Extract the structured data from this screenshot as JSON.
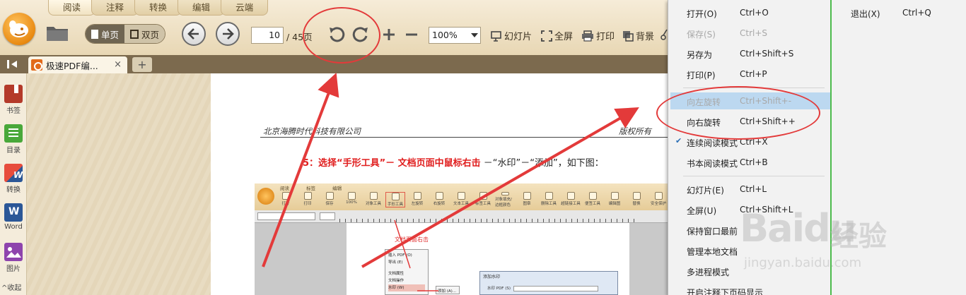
{
  "ribbon": {
    "tabs": [
      "阅读",
      "注释",
      "转换",
      "编辑",
      "云端"
    ]
  },
  "toolbar": {
    "single_page": "单页",
    "double_page": "双页",
    "page_current": "10",
    "page_total": "/ 45页",
    "zoom": "100%",
    "slideshow": "幻灯片",
    "fullscreen": "全屏",
    "print": "打印",
    "background": "背景"
  },
  "doc_tabs": {
    "active_title": "极速PDF编...",
    "close": "×",
    "add": "+"
  },
  "sidebar": {
    "items": [
      {
        "label": "书签",
        "icon": "bookmark-icon",
        "color": "#c0392b"
      },
      {
        "label": "目录",
        "icon": "toc-icon",
        "color": "#3aa33a"
      },
      {
        "label": "转换",
        "icon": "convert-icon",
        "color": "#e74c3c"
      },
      {
        "label": "Word",
        "icon": "word-icon",
        "color": "#2b5797"
      },
      {
        "label": "图片",
        "icon": "image-icon",
        "color": "#8e44ad"
      }
    ],
    "collapse": "^收起"
  },
  "page": {
    "header_left": "北京海腾时代科技有限公司",
    "header_right": "版权所有",
    "step_num": "5",
    "step_red1": "：选择“手形工具”－ 文档页面中鼠标右击",
    "step_black": " －“水印”－“添加”，如下图："
  },
  "embedded": {
    "tabs": "阅读 标签 编辑",
    "tools": [
      "打开",
      "打印",
      "保存",
      "100%",
      "对象工具",
      "手形工具",
      "左旋转",
      "右旋转",
      "文本工具",
      "标签工具",
      "对象填充/边框颜色",
      "图章",
      "删除工具",
      "超链接工具",
      "便签工具",
      "编辑图",
      "替换",
      "安全保护"
    ],
    "note": "文档页面右击",
    "menu": [
      "插入 PDF (O)",
      "导出 (E)",
      "",
      "文档属性",
      "文档操作",
      "水印 (W)"
    ],
    "submenu": "添加 (A)...",
    "dialog_title": "添加水印",
    "dialog_field": "水印 PDF (S)"
  },
  "menu": {
    "items": [
      {
        "label": "打开(O)",
        "key": "Ctrl+O",
        "state": "normal"
      },
      {
        "label": "保存(S)",
        "key": "Ctrl+S",
        "state": "disabled"
      },
      {
        "label": "另存为",
        "key": "Ctrl+Shift+S",
        "state": "normal"
      },
      {
        "label": "打印(P)",
        "key": "Ctrl+P",
        "state": "normal"
      },
      {
        "label": "向左旋转",
        "key": "Ctrl+Shift+-",
        "state": "highlight"
      },
      {
        "label": "向右旋转",
        "key": "Ctrl+Shift++",
        "state": "normal"
      },
      {
        "label": "连续阅读模式",
        "key": "Ctrl+X",
        "state": "checked"
      },
      {
        "label": "书本阅读模式",
        "key": "Ctrl+B",
        "state": "normal"
      },
      {
        "label": "幻灯片(E)",
        "key": "Ctrl+L",
        "state": "normal"
      },
      {
        "label": "全屏(U)",
        "key": "Ctrl+Shift+L",
        "state": "normal"
      },
      {
        "label": "保持窗口最前",
        "key": "",
        "state": "normal"
      },
      {
        "label": "管理本地文档",
        "key": "",
        "state": "normal"
      },
      {
        "label": "多进程模式",
        "key": "",
        "state": "normal"
      },
      {
        "label": "开启注释下页码显示",
        "key": "",
        "state": "normal"
      }
    ],
    "exit_label": "退出(X)",
    "exit_key": "Ctrl+Q"
  },
  "watermark": {
    "brand": "Baidu",
    "cn": "经验",
    "url": "jingyan.baidu.com"
  },
  "colors": {
    "annotation_red": "#e33a3a",
    "menu_highlight": "#bcd8f0",
    "separator_green": "#4dbb4d"
  }
}
